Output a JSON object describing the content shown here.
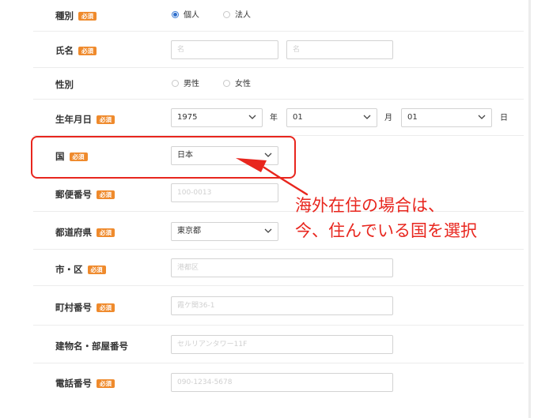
{
  "required_badge": "必須",
  "form": {
    "type": {
      "label": "種別",
      "options": [
        {
          "label": "個人",
          "selected": true
        },
        {
          "label": "法人",
          "selected": false
        }
      ]
    },
    "name": {
      "label": "氏名",
      "last_placeholder": "名",
      "first_placeholder": "名"
    },
    "gender": {
      "label": "性別",
      "options": [
        {
          "label": "男性",
          "selected": false
        },
        {
          "label": "女性",
          "selected": false
        }
      ]
    },
    "birthdate": {
      "label": "生年月日",
      "year": "1975",
      "year_unit": "年",
      "month": "01",
      "month_unit": "月",
      "day": "01",
      "day_unit": "日"
    },
    "country": {
      "label": "国",
      "value": "日本"
    },
    "postal": {
      "label": "郵便番号",
      "placeholder": "100-0013"
    },
    "prefecture": {
      "label": "都道府県",
      "value": "東京都"
    },
    "city": {
      "label": "市・区",
      "placeholder": "港都区"
    },
    "town": {
      "label": "町村番号",
      "placeholder": "霞ケ関36-1"
    },
    "building": {
      "label": "建物名・部屋番号",
      "placeholder": "セルリアンタワー11F"
    },
    "phone": {
      "label": "電話番号",
      "placeholder": "090-1234-5678"
    }
  },
  "annotation": {
    "line1": "海外在住の場合は、",
    "line2": "今、住んでいる国を選択",
    "color": "#e8261e"
  },
  "colors": {
    "badge": "#ef8a2c",
    "radio_selected": "#2f6fcc"
  }
}
